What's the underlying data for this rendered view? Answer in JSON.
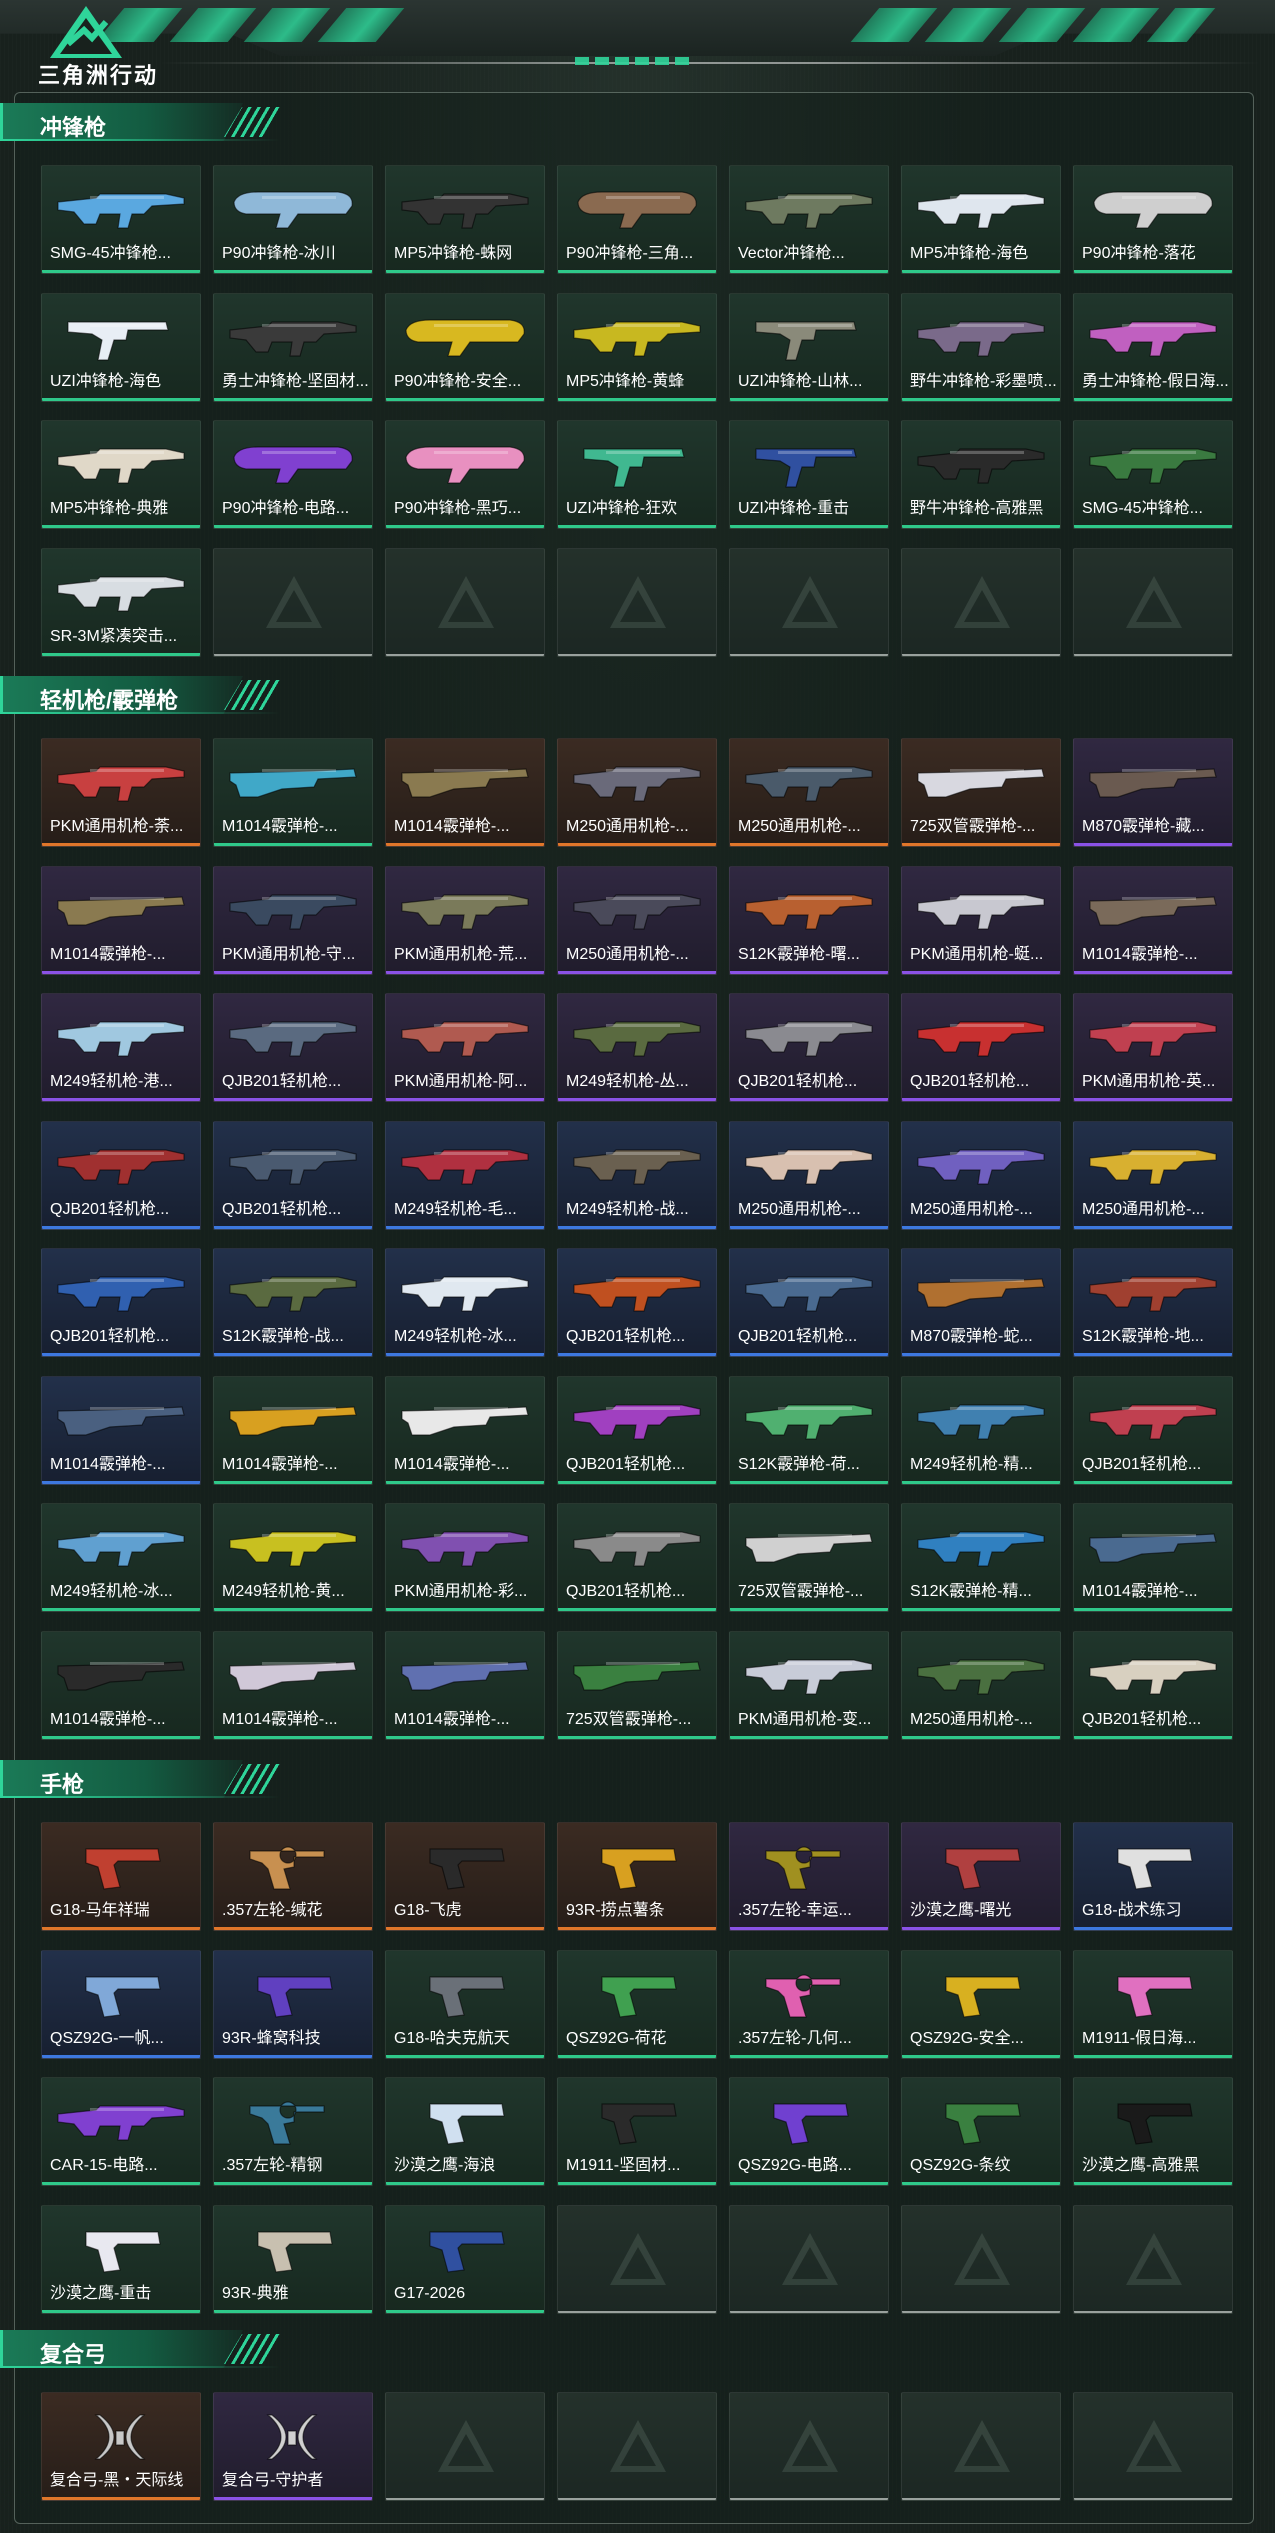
{
  "brand": {
    "title": "三角洲行动"
  },
  "colors": {
    "accent": "#2fd59a",
    "tier_green": "#2fc98a",
    "tier_orange": "#e0762a",
    "tier_purple": "#8a52e6",
    "tier_blue": "#3d78e0"
  },
  "sections": [
    {
      "title": "冲锋枪",
      "items": [
        {
          "name": "SMG-45冲锋枪...",
          "tier": "green",
          "color": "#5aa8e0",
          "icon": "smg-icon"
        },
        {
          "name": "P90冲锋枪-冰川",
          "tier": "green",
          "color": "#8fb8d8",
          "icon": "p90-icon"
        },
        {
          "name": "MP5冲锋枪-蛛网",
          "tier": "green",
          "color": "#333333",
          "icon": "mp5-icon"
        },
        {
          "name": "P90冲锋枪-三角...",
          "tier": "green",
          "color": "#8a6a50",
          "icon": "p90-icon"
        },
        {
          "name": "Vector冲锋枪...",
          "tier": "green",
          "color": "#6e7a60",
          "icon": "vector-icon"
        },
        {
          "name": "MP5冲锋枪-海色",
          "tier": "green",
          "color": "#dfe6ee",
          "icon": "mp5-icon"
        },
        {
          "name": "P90冲锋枪-落花",
          "tier": "green",
          "color": "#cfcfcf",
          "icon": "p90-icon"
        },
        {
          "name": "UZI冲锋枪-海色",
          "tier": "green",
          "color": "#e8eef5",
          "icon": "uzi-icon"
        },
        {
          "name": "勇士冲锋枪-坚固材...",
          "tier": "green",
          "color": "#3a3a3a",
          "icon": "smg-icon"
        },
        {
          "name": "P90冲锋枪-安全...",
          "tier": "green",
          "color": "#d8b820",
          "icon": "p90-icon"
        },
        {
          "name": "MP5冲锋枪-黄蜂",
          "tier": "green",
          "color": "#c8b820",
          "icon": "mp5-icon"
        },
        {
          "name": "UZI冲锋枪-山林...",
          "tier": "green",
          "color": "#8a8a7a",
          "icon": "uzi-icon"
        },
        {
          "name": "野牛冲锋枪-彩墨喷...",
          "tier": "green",
          "color": "#7a6a8a",
          "icon": "bizon-icon"
        },
        {
          "name": "勇士冲锋枪-假日海...",
          "tier": "green",
          "color": "#c060c0",
          "icon": "smg-icon"
        },
        {
          "name": "MP5冲锋枪-典雅",
          "tier": "green",
          "color": "#e0d8c8",
          "icon": "mp5-icon"
        },
        {
          "name": "P90冲锋枪-电路...",
          "tier": "green",
          "color": "#8040d0",
          "icon": "p90-icon"
        },
        {
          "name": "P90冲锋枪-黑巧...",
          "tier": "green",
          "color": "#e890c0",
          "icon": "p90-icon"
        },
        {
          "name": "UZI冲锋枪-狂欢",
          "tier": "green",
          "color": "#40b890",
          "icon": "uzi-icon"
        },
        {
          "name": "UZI冲锋枪-重击",
          "tier": "green",
          "color": "#3050a0",
          "icon": "uzi-icon"
        },
        {
          "name": "野牛冲锋枪-高雅黑",
          "tier": "green",
          "color": "#2a2a2a",
          "icon": "bizon-icon"
        },
        {
          "name": "SMG-45冲锋枪...",
          "tier": "green",
          "color": "#3a7a40",
          "icon": "smg-icon"
        },
        {
          "name": "SR-3M紧凑突击...",
          "tier": "green",
          "color": "#d8dde2",
          "icon": "sr3m-icon"
        }
      ]
    },
    {
      "title": "轻机枪/霰弹枪",
      "items": [
        {
          "name": "PKM通用机枪-荼...",
          "tier": "orange",
          "color": "#c84040",
          "icon": "lmg-icon"
        },
        {
          "name": "M1014霰弹枪-...",
          "tier": "green",
          "color": "#40a8c8",
          "icon": "shotgun-icon"
        },
        {
          "name": "M1014霰弹枪-...",
          "tier": "orange",
          "color": "#8a7a50",
          "icon": "shotgun-icon"
        },
        {
          "name": "M250通用机枪-...",
          "tier": "orange",
          "color": "#6a6a7a",
          "icon": "lmg-icon"
        },
        {
          "name": "M250通用机枪-...",
          "tier": "orange",
          "color": "#4a5a6a",
          "icon": "lmg-icon"
        },
        {
          "name": "725双管霰弹枪-...",
          "tier": "orange",
          "color": "#d8d8e0",
          "icon": "double-barrel-icon"
        },
        {
          "name": "M870霰弹枪-藏...",
          "tier": "purple",
          "color": "#6a5a50",
          "icon": "shotgun-icon"
        },
        {
          "name": "M1014霰弹枪-...",
          "tier": "purple",
          "color": "#8a7a50",
          "icon": "shotgun-icon"
        },
        {
          "name": "PKM通用机枪-守...",
          "tier": "purple",
          "color": "#3a4a60",
          "icon": "lmg-icon"
        },
        {
          "name": "PKM通用机枪-荒...",
          "tier": "purple",
          "color": "#7a7a5a",
          "icon": "lmg-icon"
        },
        {
          "name": "M250通用机枪-...",
          "tier": "purple",
          "color": "#4a4a5a",
          "icon": "lmg-icon"
        },
        {
          "name": "S12K霰弹枪-曙...",
          "tier": "purple",
          "color": "#b86030",
          "icon": "s12k-icon"
        },
        {
          "name": "PKM通用机枪-蜓...",
          "tier": "purple",
          "color": "#c8c8d0",
          "icon": "lmg-icon"
        },
        {
          "name": "M1014霰弹枪-...",
          "tier": "purple",
          "color": "#7a6a5a",
          "icon": "shotgun-icon"
        },
        {
          "name": "M249轻机枪-港...",
          "tier": "purple",
          "color": "#a0c8e0",
          "icon": "m249-icon"
        },
        {
          "name": "QJB201轻机枪...",
          "tier": "purple",
          "color": "#5a6a80",
          "icon": "lmg-icon"
        },
        {
          "name": "PKM通用机枪-阿...",
          "tier": "purple",
          "color": "#b05a50",
          "icon": "lmg-icon"
        },
        {
          "name": "M249轻机枪-丛...",
          "tier": "purple",
          "color": "#5a6a40",
          "icon": "m249-icon"
        },
        {
          "name": "QJB201轻机枪...",
          "tier": "purple",
          "color": "#8a8a90",
          "icon": "lmg-icon"
        },
        {
          "name": "QJB201轻机枪...",
          "tier": "purple",
          "color": "#c83030",
          "icon": "lmg-icon"
        },
        {
          "name": "PKM通用机枪-英...",
          "tier": "purple",
          "color": "#c04050",
          "icon": "lmg-icon"
        },
        {
          "name": "QJB201轻机枪...",
          "tier": "blue",
          "color": "#a03030",
          "icon": "lmg-icon"
        },
        {
          "name": "QJB201轻机枪...",
          "tier": "blue",
          "color": "#4a5a70",
          "icon": "lmg-icon"
        },
        {
          "name": "M249轻机枪-毛...",
          "tier": "blue",
          "color": "#b03040",
          "icon": "m249-icon"
        },
        {
          "name": "M249轻机枪-战...",
          "tier": "blue",
          "color": "#6a6050",
          "icon": "m249-icon"
        },
        {
          "name": "M250通用机枪-...",
          "tier": "blue",
          "color": "#d8c0b0",
          "icon": "lmg-icon"
        },
        {
          "name": "M250通用机枪-...",
          "tier": "blue",
          "color": "#7060c0",
          "icon": "lmg-icon"
        },
        {
          "name": "M250通用机枪-...",
          "tier": "blue",
          "color": "#d8b030",
          "icon": "lmg-icon"
        },
        {
          "name": "QJB201轻机枪...",
          "tier": "blue",
          "color": "#3060b0",
          "icon": "lmg-icon"
        },
        {
          "name": "S12K霰弹枪-战...",
          "tier": "blue",
          "color": "#5a6a40",
          "icon": "s12k-icon"
        },
        {
          "name": "M249轻机枪-冰...",
          "tier": "blue",
          "color": "#e0e8f0",
          "icon": "m249-icon"
        },
        {
          "name": "QJB201轻机枪...",
          "tier": "blue",
          "color": "#c05020",
          "icon": "lmg-icon"
        },
        {
          "name": "QJB201轻机枪...",
          "tier": "blue",
          "color": "#4a6a90",
          "icon": "lmg-icon"
        },
        {
          "name": "M870霰弹枪-蛇...",
          "tier": "blue",
          "color": "#b07030",
          "icon": "shotgun-icon"
        },
        {
          "name": "S12K霰弹枪-地...",
          "tier": "blue",
          "color": "#a04030",
          "icon": "s12k-icon"
        },
        {
          "name": "M1014霰弹枪-...",
          "tier": "blue",
          "color": "#4a6080",
          "icon": "shotgun-icon"
        },
        {
          "name": "M1014霰弹枪-...",
          "tier": "green",
          "color": "#d8a020",
          "icon": "shotgun-icon"
        },
        {
          "name": "M1014霰弹枪-...",
          "tier": "green",
          "color": "#e8e8e8",
          "icon": "shotgun-icon"
        },
        {
          "name": "QJB201轻机枪...",
          "tier": "green",
          "color": "#a040c0",
          "icon": "lmg-icon"
        },
        {
          "name": "S12K霰弹枪-荷...",
          "tier": "green",
          "color": "#50b070",
          "icon": "s12k-icon"
        },
        {
          "name": "M249轻机枪-精...",
          "tier": "green",
          "color": "#4080b0",
          "icon": "m249-icon"
        },
        {
          "name": "QJB201轻机枪...",
          "tier": "green",
          "color": "#c04050",
          "icon": "lmg-icon"
        },
        {
          "name": "M249轻机枪-冰...",
          "tier": "green",
          "color": "#60a0d0",
          "icon": "m249-icon"
        },
        {
          "name": "M249轻机枪-黄...",
          "tier": "green",
          "color": "#c8c020",
          "icon": "m249-icon"
        },
        {
          "name": "PKM通用机枪-彩...",
          "tier": "green",
          "color": "#8050b0",
          "icon": "lmg-icon"
        },
        {
          "name": "QJB201轻机枪...",
          "tier": "green",
          "color": "#8a8a8a",
          "icon": "lmg-icon"
        },
        {
          "name": "725双管霰弹枪-...",
          "tier": "green",
          "color": "#d0d0d0",
          "icon": "double-barrel-icon"
        },
        {
          "name": "S12K霰弹枪-精...",
          "tier": "green",
          "color": "#3080c0",
          "icon": "s12k-icon"
        },
        {
          "name": "M1014霰弹枪-...",
          "tier": "green",
          "color": "#4a6a90",
          "icon": "shotgun-icon"
        },
        {
          "name": "M1014霰弹枪-...",
          "tier": "green",
          "color": "#2a2a2a",
          "icon": "shotgun-icon"
        },
        {
          "name": "M1014霰弹枪-...",
          "tier": "green",
          "color": "#d0c8d8",
          "icon": "shotgun-icon"
        },
        {
          "name": "M1014霰弹枪-...",
          "tier": "green",
          "color": "#6070b0",
          "icon": "shotgun-icon"
        },
        {
          "name": "725双管霰弹枪-...",
          "tier": "green",
          "color": "#3a8040",
          "icon": "double-barrel-icon"
        },
        {
          "name": "PKM通用机枪-变...",
          "tier": "green",
          "color": "#c8ccd8",
          "icon": "lmg-icon"
        },
        {
          "name": "M250通用机枪-...",
          "tier": "green",
          "color": "#4a7040",
          "icon": "lmg-icon"
        },
        {
          "name": "QJB201轻机枪...",
          "tier": "green",
          "color": "#d8d0c0",
          "icon": "lmg-icon"
        }
      ]
    },
    {
      "title": "手枪",
      "items": [
        {
          "name": "G18-马年祥瑞",
          "tier": "orange",
          "color": "#c04030",
          "icon": "pistol-icon"
        },
        {
          "name": ".357左轮-缄花",
          "tier": "orange",
          "color": "#c89050",
          "icon": "revolver-icon"
        },
        {
          "name": "G18-飞虎",
          "tier": "orange",
          "color": "#2a2a2a",
          "icon": "pistol-icon"
        },
        {
          "name": "93R-捞点薯条",
          "tier": "orange",
          "color": "#d8a020",
          "icon": "pistol-icon"
        },
        {
          "name": ".357左轮-幸运...",
          "tier": "purple",
          "color": "#a09020",
          "icon": "revolver-icon"
        },
        {
          "name": "沙漠之鹰-曙光",
          "tier": "purple",
          "color": "#b04040",
          "icon": "deagle-icon"
        },
        {
          "name": "G18-战术练习",
          "tier": "blue",
          "color": "#e0e0e0",
          "icon": "pistol-icon"
        },
        {
          "name": "QSZ92G-一帆...",
          "tier": "blue",
          "color": "#80a8d8",
          "icon": "pistol-icon"
        },
        {
          "name": "93R-蜂窝科技",
          "tier": "blue",
          "color": "#6040c0",
          "icon": "pistol-icon"
        },
        {
          "name": "G18-哈夫克航天",
          "tier": "green",
          "color": "#6a7078",
          "icon": "pistol-icon"
        },
        {
          "name": "QSZ92G-荷花",
          "tier": "green",
          "color": "#40a050",
          "icon": "pistol-icon"
        },
        {
          "name": ".357左轮-几何...",
          "tier": "green",
          "color": "#e060b0",
          "icon": "revolver-icon"
        },
        {
          "name": "QSZ92G-安全...",
          "tier": "green",
          "color": "#d8b020",
          "icon": "pistol-icon"
        },
        {
          "name": "M1911-假日海...",
          "tier": "green",
          "color": "#e070c0",
          "icon": "pistol-icon"
        },
        {
          "name": "CAR-15-电路...",
          "tier": "green",
          "color": "#8040d0",
          "icon": "rifle-icon"
        },
        {
          "name": ".357左轮-精钢",
          "tier": "green",
          "color": "#3a7a9a",
          "icon": "revolver-icon"
        },
        {
          "name": "沙漠之鹰-海浪",
          "tier": "green",
          "color": "#d0e0f0",
          "icon": "deagle-icon"
        },
        {
          "name": "M1911-坚固材...",
          "tier": "green",
          "color": "#2a2a2a",
          "icon": "pistol-icon"
        },
        {
          "name": "QSZ92G-电路...",
          "tier": "green",
          "color": "#7040d0",
          "icon": "pistol-icon"
        },
        {
          "name": "QSZ92G-条纹",
          "tier": "green",
          "color": "#3a8040",
          "icon": "pistol-icon"
        },
        {
          "name": "沙漠之鹰-高雅黑",
          "tier": "green",
          "color": "#1a1a1a",
          "icon": "deagle-icon"
        },
        {
          "name": "沙漠之鹰-重击",
          "tier": "green",
          "color": "#e8e8f0",
          "icon": "deagle-icon"
        },
        {
          "name": "93R-典雅",
          "tier": "green",
          "color": "#c8c0b0",
          "icon": "pistol-icon"
        },
        {
          "name": "G17-2026",
          "tier": "green",
          "color": "#3050a0",
          "icon": "pistol-icon"
        }
      ]
    },
    {
      "title": "复合弓",
      "items": [
        {
          "name": "复合弓-黑・天际线",
          "tier": "orange",
          "color": "#c8c8c8",
          "icon": "bow-icon"
        },
        {
          "name": "复合弓-守护者",
          "tier": "purple",
          "color": "#d0d0d0",
          "icon": "bow-icon"
        }
      ]
    }
  ]
}
